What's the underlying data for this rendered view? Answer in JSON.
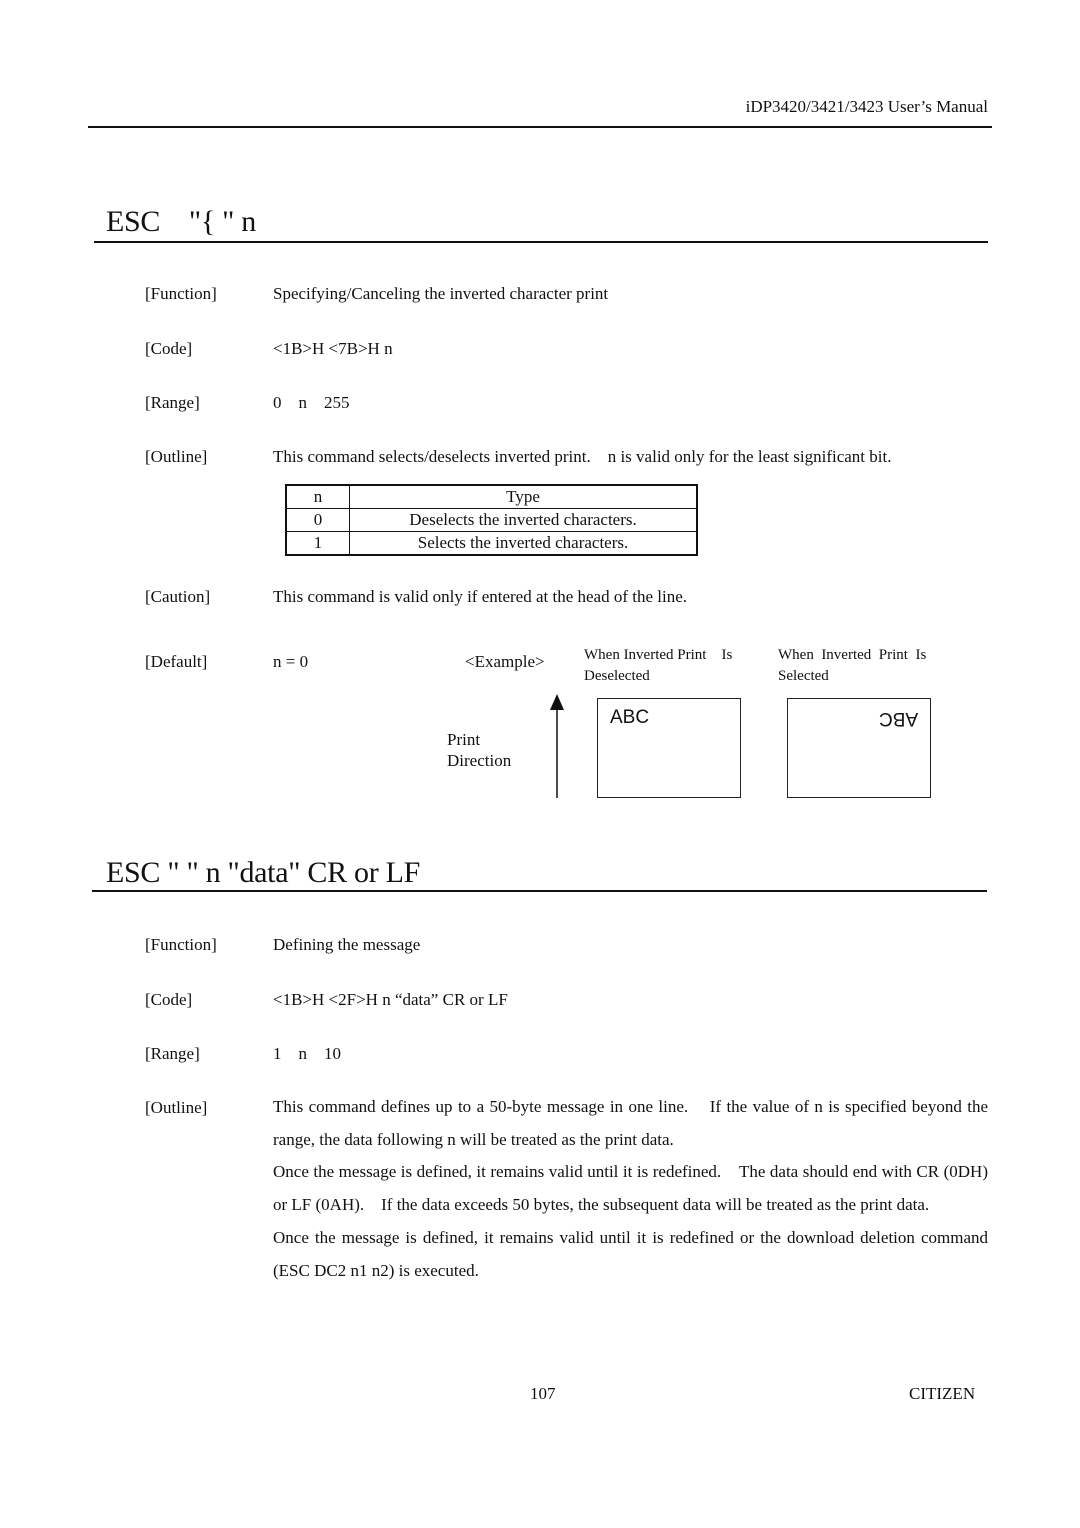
{
  "header": {
    "manual_title": "iDP3420/3421/3423 User’s Manual"
  },
  "section1": {
    "title": "ESC    \"{ \" n",
    "function_label": "[Function]",
    "function_value": "Specifying/Canceling the inverted character print",
    "code_label": "[Code]",
    "code_value": "<1B>H <7B>H n",
    "range_label": "[Range]",
    "range_value": "0    n    255",
    "outline_label": "[Outline]",
    "outline_value": "This command selects/deselects inverted print.    n is valid only for the least significant bit.",
    "table": {
      "headers": [
        "n",
        "Type"
      ],
      "rows": [
        [
          "0",
          "Deselects the inverted characters."
        ],
        [
          "1",
          "Selects the inverted characters."
        ]
      ]
    },
    "caution_label": "[Caution]",
    "caution_value": "This command is valid only if entered at the head of the line.",
    "default_label": "[Default]",
    "default_value": "n = 0",
    "example": {
      "label": "<Example>",
      "deselected_caption_line1": "When Inverted Print    Is",
      "deselected_caption_line2": "Deselected",
      "selected_caption_line1": "When  Inverted  Print  Is",
      "selected_caption_line2": "Selected",
      "print_label_line1": "Print",
      "print_label_line2": "Direction",
      "sample_text": "ABC",
      "inverted_sample_text": "ABC"
    }
  },
  "section2": {
    "title": "ESC \" \" n \"data\" CR or LF",
    "function_label": "[Function]",
    "function_value": "Defining the message",
    "code_label": "[Code]",
    "code_value": "<1B>H <2F>H n “data” CR or LF",
    "range_label": "[Range]",
    "range_value": "1    n    10",
    "outline_label": "[Outline]",
    "outline_paragraphs": [
      "This command defines up to a 50-byte message in one line.    If the value of n is specified beyond the range, the data following n will be treated as the print data.",
      "Once the message is defined, it remains valid until it is redefined.    The data should end with CR (0DH) or LF (0AH).    If the data exceeds 50 bytes, the subsequent data will be treated as the print data.",
      "Once the message is defined, it remains valid until it is redefined or the download deletion command (ESC DC2 n1 n2) is executed."
    ]
  },
  "footer": {
    "page_number": "107",
    "brand": "CITIZEN"
  }
}
